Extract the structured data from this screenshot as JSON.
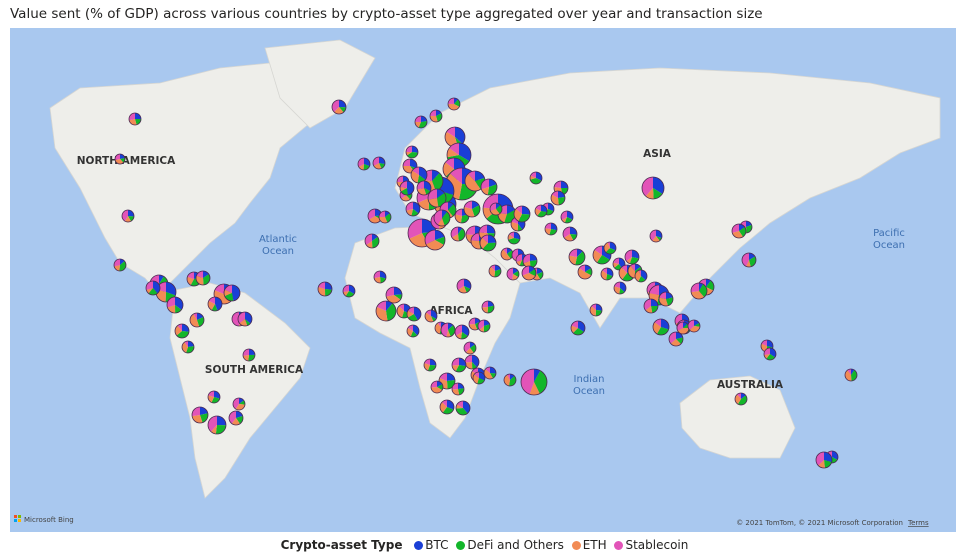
{
  "title": "Value sent (% of GDP) across various countries by crypto-asset type aggregated over year and transaction size",
  "map": {
    "continent_labels": [
      {
        "key": "na",
        "text": "NORTH AMERICA"
      },
      {
        "key": "sa",
        "text": "SOUTH AMERICA"
      },
      {
        "key": "af",
        "text": "AFRICA"
      },
      {
        "key": "as",
        "text": "ASIA"
      },
      {
        "key": "au",
        "text": "AUSTRALIA"
      }
    ],
    "ocean_labels": [
      {
        "key": "atl",
        "lines": [
          "Atlantic",
          "Ocean"
        ]
      },
      {
        "key": "ind",
        "lines": [
          "Indian",
          "Ocean"
        ]
      },
      {
        "key": "pac",
        "lines": [
          "Pacific",
          "Ocean"
        ]
      }
    ],
    "bing_logo_text": "Microsoft Bing",
    "copyright": "© 2021 TomTom, © 2021 Microsoft Corporation",
    "terms_link": "Terms"
  },
  "legend": {
    "title": "Crypto-asset Type",
    "items": [
      {
        "label": "BTC",
        "color": "#1a3fd6"
      },
      {
        "label": "DeFi and Others",
        "color": "#13b62a"
      },
      {
        "label": "ETH",
        "color": "#f28b54"
      },
      {
        "label": "Stablecoin",
        "color": "#e254b8"
      }
    ]
  },
  "colors": {
    "ocean": "#a9c8ef",
    "land": "#eeeeea",
    "btc": "#1a3fd6",
    "defi": "#13b62a",
    "eth": "#f28b54",
    "stable": "#e254b8"
  }
}
